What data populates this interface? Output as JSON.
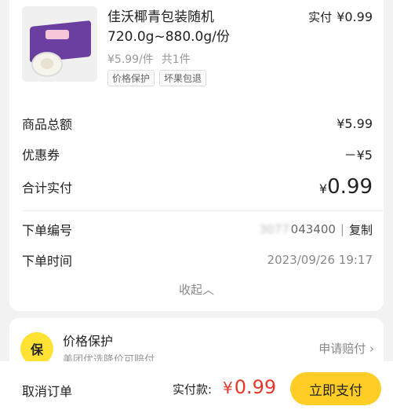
{
  "product": {
    "title": "佳沃椰青包装随机 720.0g~880.0g/份",
    "paid_label": "实付",
    "paid_amount": "¥0.99",
    "unit_price": "¥5.99/件",
    "quantity": "共1件",
    "tags": [
      "价格保护",
      "坏果包退"
    ]
  },
  "summary": {
    "total_label": "商品总额",
    "total_value": "¥5.99",
    "coupon_label": "优惠券",
    "coupon_value": "－¥5",
    "paid_label": "合计实付",
    "paid_currency": "¥",
    "paid_value": "0.99"
  },
  "order": {
    "number_label": "下单编号",
    "number_hidden": "3077",
    "number_value": "043400",
    "copy_label": "复制",
    "time_label": "下单时间",
    "time_value": "2023/09/26 19:17",
    "collapse_label": "收起"
  },
  "protection": {
    "icon_text": "保",
    "title": "价格保护",
    "description": "美团优选降价可赔付",
    "action_label": "申请赔付"
  },
  "bottom": {
    "cancel_label": "取消订单",
    "pay_label": "实付款:",
    "pay_currency": "¥",
    "pay_amount": "0.99",
    "pay_button": "立即支付"
  }
}
